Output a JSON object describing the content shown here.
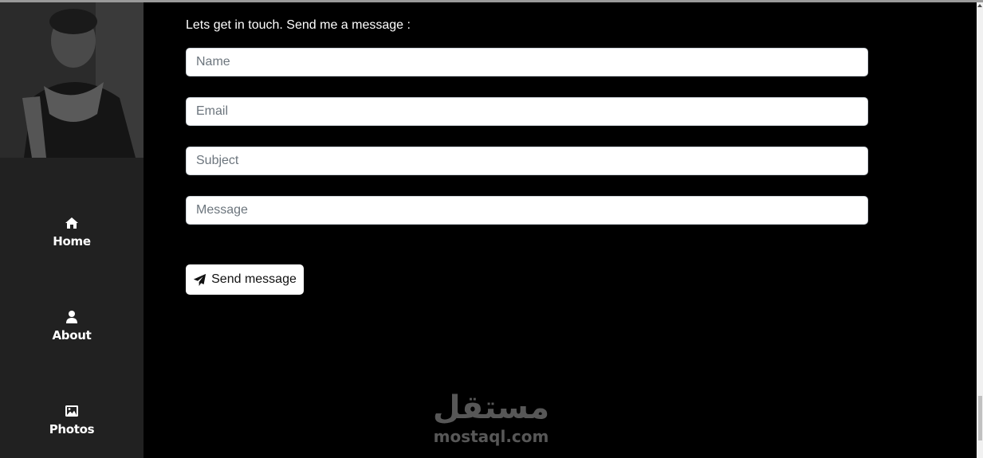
{
  "sidebar": {
    "nav": [
      {
        "label": "Home",
        "icon": "home-icon"
      },
      {
        "label": "About",
        "icon": "user-icon"
      },
      {
        "label": "Photos",
        "icon": "image-icon"
      }
    ]
  },
  "contact": {
    "intro": "Lets get in touch. Send me a message :",
    "fields": {
      "name_placeholder": "Name",
      "email_placeholder": "Email",
      "subject_placeholder": "Subject",
      "message_placeholder": "Message"
    },
    "send_label": "Send message",
    "send_icon": "paper-plane-icon"
  },
  "watermark": {
    "arabic": "مستقل",
    "latin": "mostaql.com"
  },
  "colors": {
    "page_bg": "#000000",
    "sidebar_bg": "#212121",
    "text": "#ffffff",
    "watermark": "#575757"
  }
}
